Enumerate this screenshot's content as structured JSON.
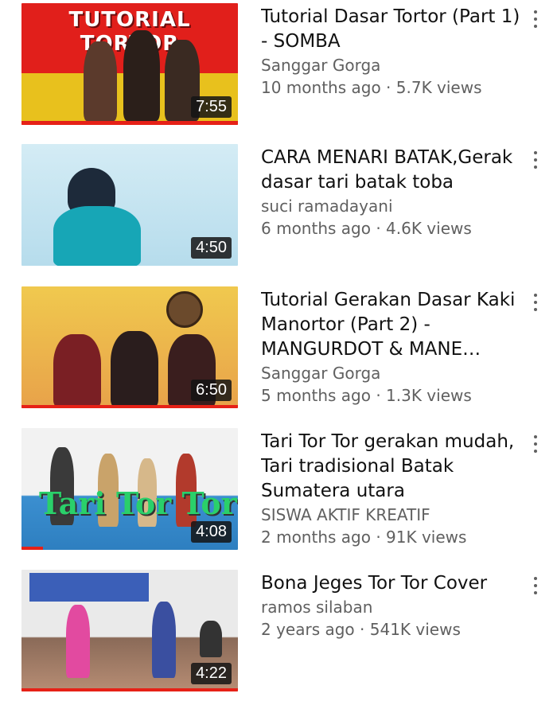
{
  "videos": [
    {
      "title": "Tutorial Dasar Tortor (Part 1) - SOMBA",
      "channel": "Sanggar Gorga",
      "stats": "10 months ago · 5.7K views",
      "duration": "7:55",
      "thumbnail_text": "TUTORIAL TORTOR"
    },
    {
      "title": "CARA MENARI BATAK,Gerak dasar tari batak toba",
      "channel": "suci ramadayani",
      "stats": "6 months ago · 4.6K views",
      "duration": "4:50"
    },
    {
      "title": "Tutorial Gerakan Dasar Kaki Manortor (Part 2) - MANGURDOT & MANE…",
      "channel": "Sanggar Gorga",
      "stats": "5 months ago · 1.3K views",
      "duration": "6:50"
    },
    {
      "title": "Tari Tor Tor gerakan mudah, Tari tradisional Batak Sumatera utara",
      "channel": "SISWA AKTIF KREATIF",
      "stats": "2 months ago · 91K views",
      "duration": "4:08",
      "thumbnail_text": "Tari Tor Tor",
      "watch_progress": 0.1
    },
    {
      "title": "Bona Jeges Tor Tor Cover",
      "channel": "ramos silaban",
      "stats": "2 years ago · 541K views",
      "duration": "4:22"
    }
  ],
  "colors": {
    "progress": "#e62117",
    "meta_text": "#606060",
    "title_text": "#111111"
  },
  "icons": {
    "more": "more-vert-icon"
  }
}
